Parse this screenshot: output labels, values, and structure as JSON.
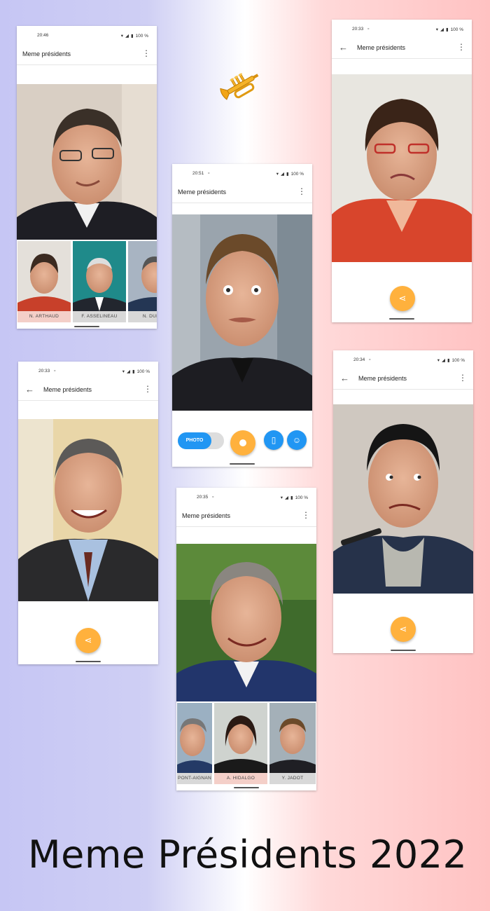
{
  "headline": "Meme Présidents 2022",
  "decoration": {
    "icon": "trumpet-icon"
  },
  "colors": {
    "accent": "#ffb13d",
    "blue": "#2196f3",
    "bg_left": "#c6c6f4",
    "bg_right": "#ffc2c2"
  },
  "screens": [
    {
      "time": "20:46",
      "battery": "100 %",
      "title": "Meme présidents",
      "thumbnails": [
        "N. ARTHAUD",
        "F. ASSELINEAU",
        "N. DUPON"
      ]
    },
    {
      "time": "20:33",
      "battery": "100 %",
      "title": "Meme présidents"
    },
    {
      "time": "20:51",
      "battery": "100 %",
      "title": "Meme présidents",
      "mode_toggle": "PHOTO"
    },
    {
      "time": "20:33",
      "battery": "100 %",
      "title": "Meme présidents"
    },
    {
      "time": "20:34",
      "battery": "100 %",
      "title": "Meme présidents"
    },
    {
      "time": "20:35",
      "battery": "100 %",
      "title": "Meme présidents",
      "thumbnails": [
        "PONT-AIGNAN",
        "A. HIDALGO",
        "Y. JADOT"
      ]
    }
  ]
}
